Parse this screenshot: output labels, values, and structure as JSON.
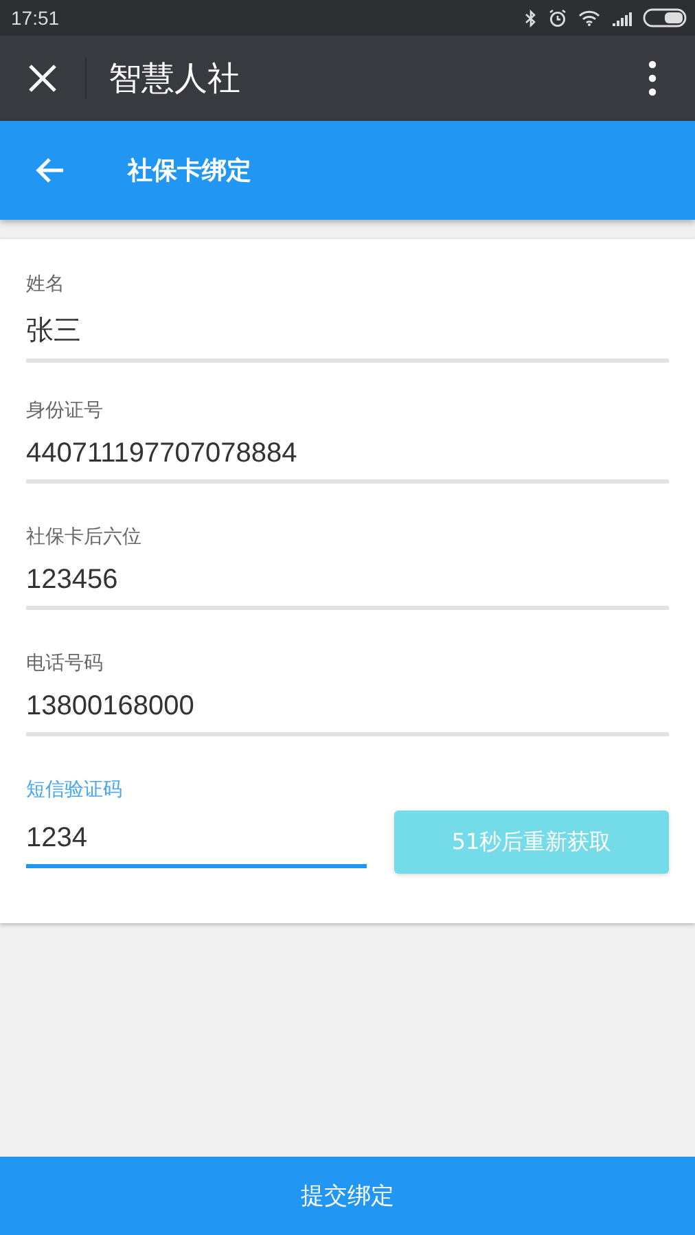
{
  "status_bar": {
    "time": "17:51"
  },
  "title_bar": {
    "title": "智慧人社"
  },
  "header": {
    "title": "社保卡绑定"
  },
  "fields": [
    {
      "label": "姓名",
      "value": "张三",
      "focused": false
    },
    {
      "label": "身份证号",
      "value": "440711197707078884",
      "focused": false
    },
    {
      "label": "社保卡后六位",
      "value": "123456",
      "focused": false
    },
    {
      "label": "电话号码",
      "value": "13800168000",
      "focused": false
    },
    {
      "label": "短信验证码",
      "value": "1234",
      "focused": true,
      "button": {
        "label": "51秒后重新获取",
        "disabled": true
      }
    }
  ],
  "submit": {
    "label": "提交绑定"
  }
}
